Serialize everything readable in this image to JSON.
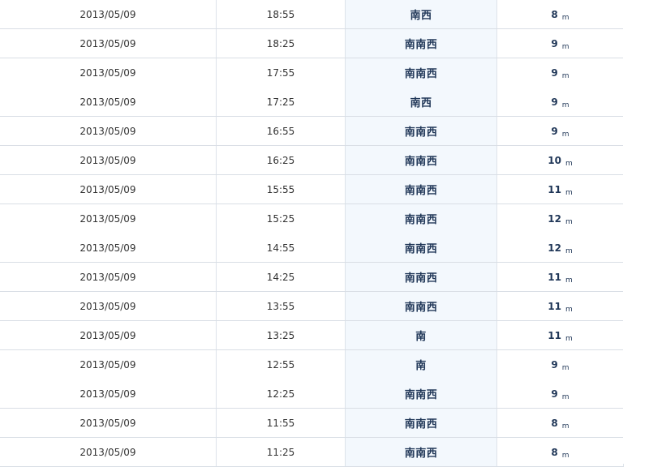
{
  "unit": "m",
  "rows": [
    {
      "date": "2013/05/09",
      "time": "18:55",
      "direction": "南西",
      "speed": "8"
    },
    {
      "date": "2013/05/09",
      "time": "18:25",
      "direction": "南南西",
      "speed": "9"
    },
    {
      "date": "2013/05/09",
      "time": "17:55",
      "direction": "南南西",
      "speed": "9"
    },
    {
      "date": "2013/05/09",
      "time": "17:25",
      "direction": "南西",
      "speed": "9"
    },
    {
      "date": "2013/05/09",
      "time": "16:55",
      "direction": "南南西",
      "speed": "9"
    },
    {
      "date": "2013/05/09",
      "time": "16:25",
      "direction": "南南西",
      "speed": "10"
    },
    {
      "date": "2013/05/09",
      "time": "15:55",
      "direction": "南南西",
      "speed": "11"
    },
    {
      "date": "2013/05/09",
      "time": "15:25",
      "direction": "南南西",
      "speed": "12"
    },
    {
      "date": "2013/05/09",
      "time": "14:55",
      "direction": "南南西",
      "speed": "12"
    },
    {
      "date": "2013/05/09",
      "time": "14:25",
      "direction": "南南西",
      "speed": "11"
    },
    {
      "date": "2013/05/09",
      "time": "13:55",
      "direction": "南南西",
      "speed": "11"
    },
    {
      "date": "2013/05/09",
      "time": "13:25",
      "direction": "南",
      "speed": "11"
    },
    {
      "date": "2013/05/09",
      "time": "12:55",
      "direction": "南",
      "speed": "9"
    },
    {
      "date": "2013/05/09",
      "time": "12:25",
      "direction": "南南西",
      "speed": "9"
    },
    {
      "date": "2013/05/09",
      "time": "11:55",
      "direction": "南南西",
      "speed": "8"
    },
    {
      "date": "2013/05/09",
      "time": "11:25",
      "direction": "南南西",
      "speed": "8"
    }
  ]
}
